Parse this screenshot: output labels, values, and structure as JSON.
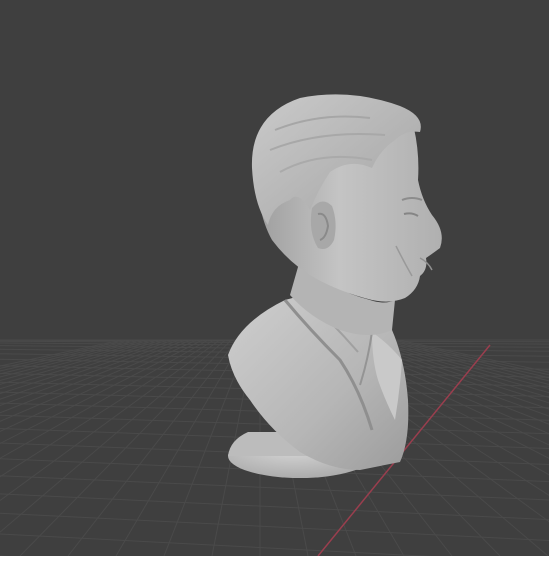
{
  "app": {
    "view": "3d-viewport",
    "shading": "solid",
    "colors": {
      "background": "#3f3f3f",
      "grid_line": "#4a4a4a",
      "x_axis": "#9a3e4e",
      "model": "#bdbdbd"
    }
  },
  "scene": {
    "object": {
      "kind": "sculpted-bust",
      "icon": "bust-model-icon"
    },
    "grid": {
      "visible": true
    },
    "axis": {
      "x_visible": true
    }
  }
}
